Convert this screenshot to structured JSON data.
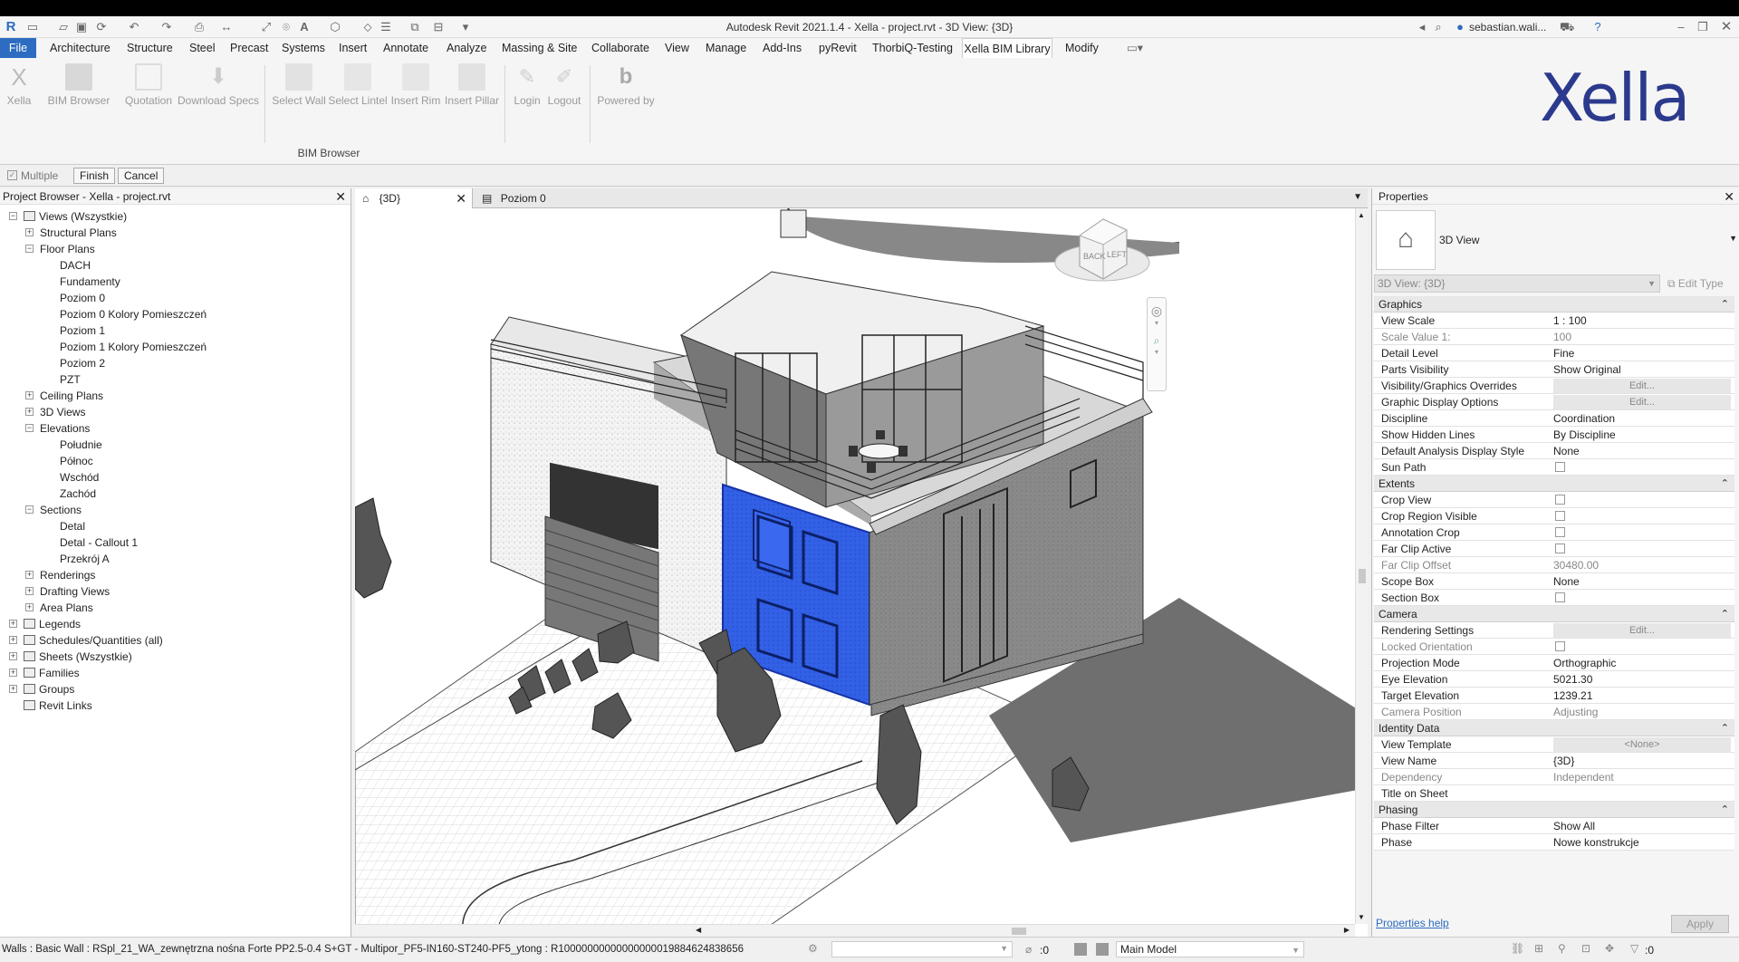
{
  "title": "Autodesk Revit 2021.1.4 - Xella - project.rvt - 3D View: {3D}",
  "user": "sebastian.wali...",
  "menu": [
    "File",
    "Architecture",
    "Structure",
    "Steel",
    "Precast",
    "Systems",
    "Insert",
    "Annotate",
    "Analyze",
    "Massing & Site",
    "Collaborate",
    "View",
    "Manage",
    "Add-Ins",
    "pyRevit",
    "ThorbiQ-Testing",
    "Xella BIM Library",
    "Modify"
  ],
  "ribbon": {
    "buttons": [
      "Xella",
      "BIM Browser",
      "Quotation",
      "Download Specs",
      "Select Wall",
      "Select Lintel",
      "Insert Rim",
      "Insert Pillar",
      "Login",
      "Logout",
      "Powered by"
    ],
    "panel_label": "BIM Browser",
    "logo": "Xella"
  },
  "options": {
    "multiple": "Multiple",
    "finish": "Finish",
    "cancel": "Cancel"
  },
  "project_browser": {
    "title": "Project Browser - Xella - project.rvt",
    "items": [
      {
        "label": "Views (Wszystkie)",
        "level": 0,
        "exp": "-",
        "icon": true
      },
      {
        "label": "Structural Plans",
        "level": 1,
        "exp": "+"
      },
      {
        "label": "Floor Plans",
        "level": 1,
        "exp": "-"
      },
      {
        "label": "DACH",
        "level": 2
      },
      {
        "label": "Fundamenty",
        "level": 2
      },
      {
        "label": "Poziom 0",
        "level": 2
      },
      {
        "label": "Poziom 0 Kolory Pomieszczeń",
        "level": 2
      },
      {
        "label": "Poziom 1",
        "level": 2
      },
      {
        "label": "Poziom 1 Kolory Pomieszczeń",
        "level": 2
      },
      {
        "label": "Poziom 2",
        "level": 2
      },
      {
        "label": "PZT",
        "level": 2
      },
      {
        "label": "Ceiling Plans",
        "level": 1,
        "exp": "+"
      },
      {
        "label": "3D Views",
        "level": 1,
        "exp": "+"
      },
      {
        "label": "Elevations",
        "level": 1,
        "exp": "-"
      },
      {
        "label": "Południe",
        "level": 2
      },
      {
        "label": "Północ",
        "level": 2
      },
      {
        "label": "Wschód",
        "level": 2
      },
      {
        "label": "Zachód",
        "level": 2
      },
      {
        "label": "Sections",
        "level": 1,
        "exp": "-"
      },
      {
        "label": "Detal",
        "level": 2
      },
      {
        "label": "Detal - Callout 1",
        "level": 2
      },
      {
        "label": "Przekrój A",
        "level": 2
      },
      {
        "label": "Renderings",
        "level": 1,
        "exp": "+"
      },
      {
        "label": "Drafting Views",
        "level": 1,
        "exp": "+"
      },
      {
        "label": "Area Plans",
        "level": 1,
        "exp": "+"
      },
      {
        "label": "Legends",
        "level": 0,
        "exp": "+",
        "icon": true
      },
      {
        "label": "Schedules/Quantities (all)",
        "level": 0,
        "exp": "+",
        "icon": true
      },
      {
        "label": "Sheets (Wszystkie)",
        "level": 0,
        "exp": "+",
        "icon": true
      },
      {
        "label": "Families",
        "level": 0,
        "exp": "+",
        "icon": true
      },
      {
        "label": "Groups",
        "level": 0,
        "exp": "+",
        "icon": true
      },
      {
        "label": "Revit Links",
        "level": 0,
        "icon": true
      }
    ]
  },
  "view_tabs": [
    {
      "label": "{3D}",
      "active": true
    },
    {
      "label": "Poziom 0",
      "active": false
    }
  ],
  "viewcube": {
    "back": "BACK",
    "left": "LEFT"
  },
  "properties": {
    "title": "Properties",
    "type_name": "3D View",
    "selector": "3D View: {3D}",
    "edit_type": "Edit Type",
    "help": "Properties help",
    "apply": "Apply",
    "groups": [
      {
        "name": "Graphics",
        "rows": [
          {
            "n": "View Scale",
            "v": "1 : 100"
          },
          {
            "n": "Scale Value    1:",
            "v": "100",
            "gray": true
          },
          {
            "n": "Detail Level",
            "v": "Fine"
          },
          {
            "n": "Parts Visibility",
            "v": "Show Original"
          },
          {
            "n": "Visibility/Graphics Overrides",
            "btn": "Edit..."
          },
          {
            "n": "Graphic Display Options",
            "btn": "Edit..."
          },
          {
            "n": "Discipline",
            "v": "Coordination"
          },
          {
            "n": "Show Hidden Lines",
            "v": "By Discipline"
          },
          {
            "n": "Default Analysis Display Style",
            "v": "None"
          },
          {
            "n": "Sun Path",
            "chk": true
          }
        ]
      },
      {
        "name": "Extents",
        "rows": [
          {
            "n": "Crop View",
            "chk": true
          },
          {
            "n": "Crop Region Visible",
            "chk": true
          },
          {
            "n": "Annotation Crop",
            "chk": true
          },
          {
            "n": "Far Clip Active",
            "chk": true
          },
          {
            "n": "Far Clip Offset",
            "v": "30480.00",
            "gray": true
          },
          {
            "n": "Scope Box",
            "v": "None"
          },
          {
            "n": "Section Box",
            "chk": true
          }
        ]
      },
      {
        "name": "Camera",
        "rows": [
          {
            "n": "Rendering Settings",
            "btn": "Edit..."
          },
          {
            "n": "Locked Orientation",
            "chk": true,
            "gray": true
          },
          {
            "n": "Projection Mode",
            "v": "Orthographic"
          },
          {
            "n": "Eye Elevation",
            "v": "5021.30"
          },
          {
            "n": "Target Elevation",
            "v": "1239.21"
          },
          {
            "n": "Camera Position",
            "v": "Adjusting",
            "gray": true
          }
        ]
      },
      {
        "name": "Identity Data",
        "rows": [
          {
            "n": "View Template",
            "btn": "<None>"
          },
          {
            "n": "View Name",
            "v": "{3D}"
          },
          {
            "n": "Dependency",
            "v": "Independent",
            "gray": true
          },
          {
            "n": "Title on Sheet",
            "v": ""
          }
        ]
      },
      {
        "name": "Phasing",
        "rows": [
          {
            "n": "Phase Filter",
            "v": "Show All"
          },
          {
            "n": "Phase",
            "v": "Nowe konstrukcje"
          }
        ]
      }
    ]
  },
  "status": {
    "text": "Walls : Basic Wall : RSpl_21_WA_zewnętrzna nośna Forte PP2.5-0.4 S+GT - Multipor_PF5-IN160-ST240-PF5_ytong : R10000000000000000019884624838656",
    "count": ":0",
    "model": "Main Model",
    "filter": ":0"
  },
  "colors": {
    "accent": "#2d6cc0",
    "selection": "#2f5fe0",
    "logo": "#2b3a8c"
  }
}
